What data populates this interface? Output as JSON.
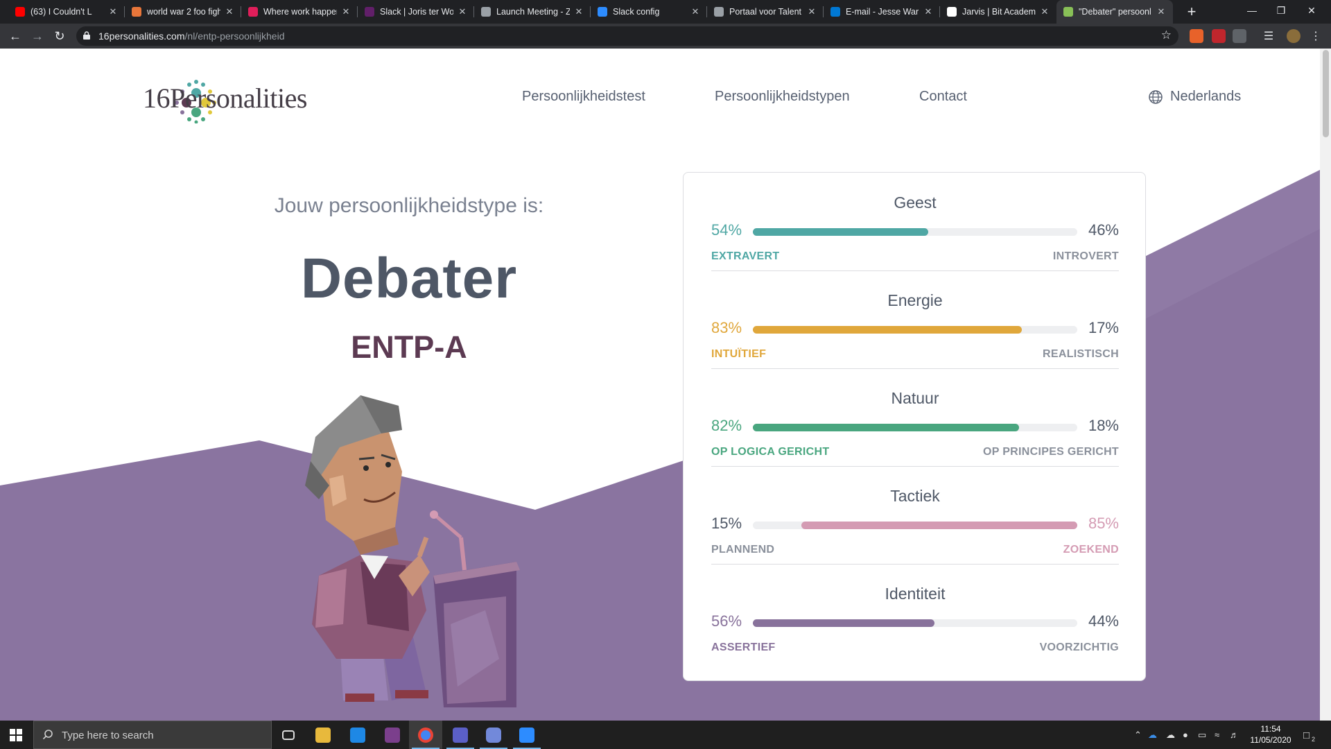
{
  "browser": {
    "tabs": [
      {
        "title": "(63) I Couldn't L",
        "favicon_color": "#ff0000"
      },
      {
        "title": "world war 2 foo figh",
        "favicon_color": "#e8763a"
      },
      {
        "title": "Where work happens",
        "favicon_color": "#e01e5a"
      },
      {
        "title": "Slack | Joris ter Wolf",
        "favicon_color": "#611f69"
      },
      {
        "title": "Launch Meeting - Z",
        "favicon_color": "#9aa0a6"
      },
      {
        "title": "Slack config",
        "favicon_color": "#2d8cff"
      },
      {
        "title": "Portaal voor Talent",
        "favicon_color": "#9aa0a6"
      },
      {
        "title": "E-mail - Jesse Warm",
        "favicon_color": "#0078d4"
      },
      {
        "title": "Jarvis | Bit Academy",
        "favicon_color": "#ffffff"
      },
      {
        "title": "\"Debater\" persoonl",
        "favicon_color": "#88c057"
      }
    ],
    "new_tab": "+",
    "url_host": "16personalities.com",
    "url_path": "/nl/entp-persoonlijkheid"
  },
  "site": {
    "logo_text": "16Personalities",
    "nav": [
      "Persoonlijkheidstest",
      "Persoonlijkheidstypen",
      "Contact"
    ],
    "language": "Nederlands"
  },
  "result": {
    "intro": "Jouw persoonlijkheidstype is:",
    "type_name": "Debater",
    "type_code": "ENTP-A"
  },
  "traits": [
    {
      "name": "Geest",
      "left_pct": "54%",
      "right_pct": "46%",
      "left_label": "EXTRAVERT",
      "right_label": "INTROVERT",
      "dominant": "left",
      "fill_fraction": 0.54,
      "color": "#4fa7a4"
    },
    {
      "name": "Energie",
      "left_pct": "83%",
      "right_pct": "17%",
      "left_label": "INTUÏTIEF",
      "right_label": "REALISTISCH",
      "dominant": "left",
      "fill_fraction": 0.83,
      "color": "#e0a73b"
    },
    {
      "name": "Natuur",
      "left_pct": "82%",
      "right_pct": "18%",
      "left_label": "OP LOGICA GERICHT",
      "right_label": "OP PRINCIPES GERICHT",
      "dominant": "left",
      "fill_fraction": 0.82,
      "color": "#49a67f"
    },
    {
      "name": "Tactiek",
      "left_pct": "15%",
      "right_pct": "85%",
      "left_label": "PLANNEND",
      "right_label": "ZOEKEND",
      "dominant": "right",
      "fill_fraction": 0.85,
      "color": "#d49bb3"
    },
    {
      "name": "Identiteit",
      "left_pct": "56%",
      "right_pct": "44%",
      "left_label": "ASSERTIEF",
      "right_label": "VOORZICHTIG",
      "dominant": "left",
      "fill_fraction": 0.56,
      "color": "#88729b"
    }
  ],
  "taskbar": {
    "search_placeholder": "Type here to search",
    "time": "11:54",
    "date": "11/05/2020",
    "notification_count": "2"
  }
}
